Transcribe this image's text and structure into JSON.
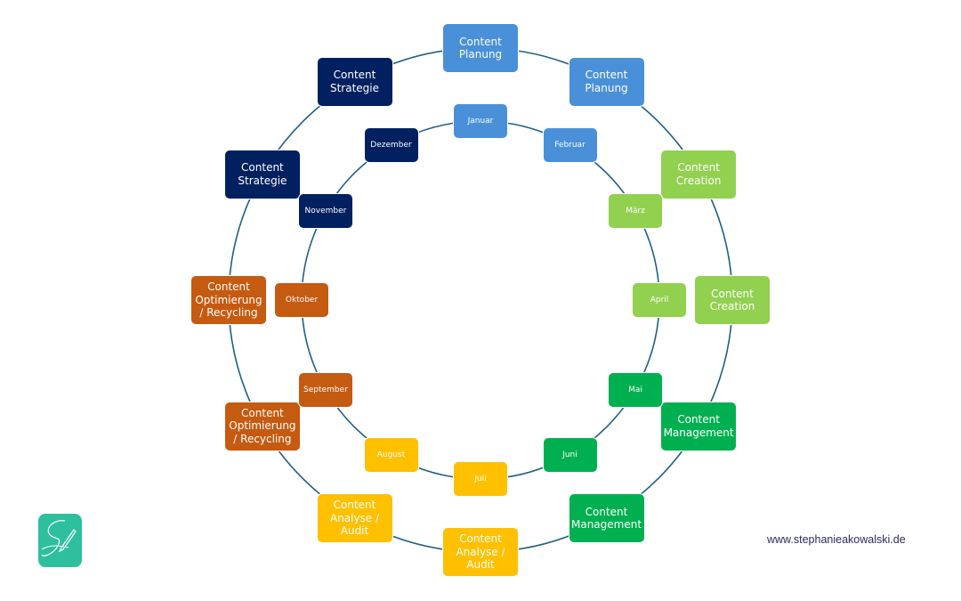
{
  "colors": {
    "ring": "#1f5f86",
    "planung": "#4a90d9",
    "creation": "#92d050",
    "management": "#00b050",
    "analyse": "#ffc000",
    "optimierung": "#c55a11",
    "strategie": "#002060"
  },
  "outer_ring": [
    {
      "label": "Content Planung",
      "phase": "planung"
    },
    {
      "label": "Content Planung",
      "phase": "planung"
    },
    {
      "label": "Content Creation",
      "phase": "creation"
    },
    {
      "label": "Content Creation",
      "phase": "creation"
    },
    {
      "label": "Content Management",
      "phase": "management"
    },
    {
      "label": "Content Management",
      "phase": "management"
    },
    {
      "label": "Content Analyse / Audit",
      "phase": "analyse"
    },
    {
      "label": "Content Analyse / Audit",
      "phase": "analyse"
    },
    {
      "label": "Content Optimierung / Recycling",
      "phase": "optimierung"
    },
    {
      "label": "Content Optimierung / Recycling",
      "phase": "optimierung"
    },
    {
      "label": "Content Strategie",
      "phase": "strategie"
    },
    {
      "label": "Content Strategie",
      "phase": "strategie"
    }
  ],
  "inner_ring": [
    {
      "label": "Januar",
      "phase": "planung"
    },
    {
      "label": "Februar",
      "phase": "planung"
    },
    {
      "label": "März",
      "phase": "creation"
    },
    {
      "label": "April",
      "phase": "creation"
    },
    {
      "label": "Mai",
      "phase": "management"
    },
    {
      "label": "Juni",
      "phase": "management"
    },
    {
      "label": "Juli",
      "phase": "analyse"
    },
    {
      "label": "August",
      "phase": "analyse"
    },
    {
      "label": "September",
      "phase": "optimierung"
    },
    {
      "label": "Oktober",
      "phase": "optimierung"
    },
    {
      "label": "November",
      "phase": "strategie"
    },
    {
      "label": "Dezember",
      "phase": "strategie"
    }
  ],
  "logo": {
    "icon": "signature-pen-icon",
    "color": "#2ebf9f"
  },
  "footer": {
    "url": "www.stephanieakowalski.de"
  }
}
